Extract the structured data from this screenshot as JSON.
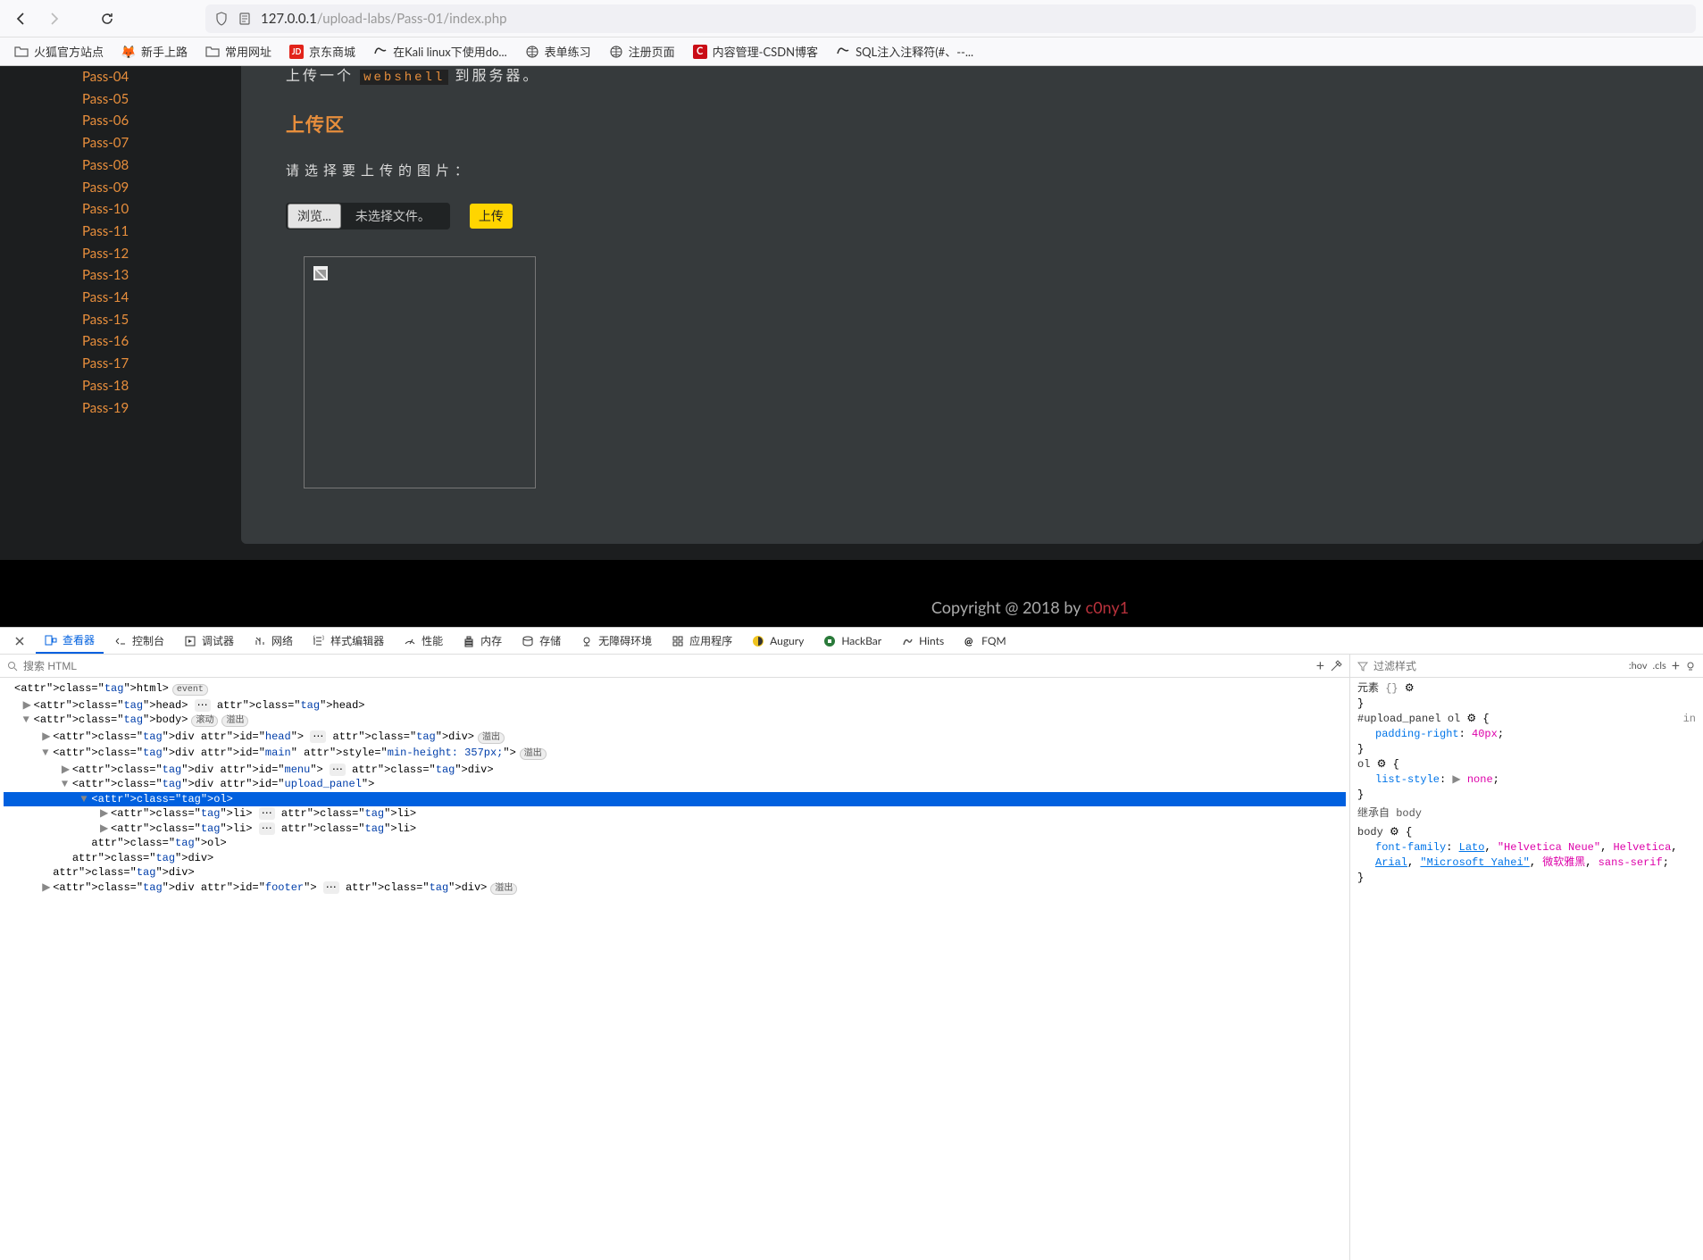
{
  "browser": {
    "url_host": "127.0.0.1",
    "url_path": "/upload-labs/Pass-01/index.php"
  },
  "bookmarks": [
    {
      "icon": "folder",
      "label": "火狐官方站点"
    },
    {
      "icon": "fox",
      "label": "新手上路"
    },
    {
      "icon": "folder",
      "label": "常用网址"
    },
    {
      "icon": "jd",
      "label": "京东商城"
    },
    {
      "icon": "kali",
      "label": "在Kali linux下使用do..."
    },
    {
      "icon": "globe",
      "label": "表单练习"
    },
    {
      "icon": "globe",
      "label": "注册页面"
    },
    {
      "icon": "c",
      "label": "内容管理-CSDN博客"
    },
    {
      "icon": "kali",
      "label": "SQL注入注释符(#、--..."
    }
  ],
  "sidebar": {
    "items": [
      "Pass-04",
      "Pass-05",
      "Pass-06",
      "Pass-07",
      "Pass-08",
      "Pass-09",
      "Pass-10",
      "Pass-11",
      "Pass-12",
      "Pass-13",
      "Pass-14",
      "Pass-15",
      "Pass-16",
      "Pass-17",
      "Pass-18",
      "Pass-19"
    ]
  },
  "content": {
    "task_prefix": "上传一个",
    "task_code": "webshell",
    "task_suffix": "到服务器。",
    "upload_heading": "上传区",
    "upload_prompt": "请选择要上传的图片：",
    "browse_label": "浏览...",
    "file_status": "未选择文件。",
    "submit_label": "上传"
  },
  "footer": {
    "copyright": "Copyright @ 2018 by",
    "author": "c0ny1"
  },
  "devtools": {
    "tabs": [
      "查看器",
      "控制台",
      "调试器",
      "网络",
      "样式编辑器",
      "性能",
      "内存",
      "存储",
      "无障碍环境",
      "应用程序",
      "Augury",
      "HackBar",
      "Hints",
      "FQM"
    ],
    "search_placeholder": "搜索 HTML",
    "html_lines": [
      {
        "indent": 0,
        "arrow": "",
        "text": "<html>",
        "badge": "event"
      },
      {
        "indent": 1,
        "arrow": "▶",
        "text": "<head> … </head>"
      },
      {
        "indent": 1,
        "arrow": "▼",
        "text": "<body>",
        "badges": [
          "滚动",
          "溢出"
        ]
      },
      {
        "indent": 2,
        "arrow": "▶",
        "text": "<div id=\"head\"> … </div>",
        "badge": "溢出"
      },
      {
        "indent": 2,
        "arrow": "▼",
        "text": "<div id=\"main\" style=\"min-height: 357px;\">",
        "badge": "溢出"
      },
      {
        "indent": 3,
        "arrow": "▶",
        "text": "<div id=\"menu\"> … </div>"
      },
      {
        "indent": 3,
        "arrow": "▼",
        "text": "<div id=\"upload_panel\">"
      },
      {
        "indent": 4,
        "arrow": "▼",
        "text": "<ol>",
        "selected": true
      },
      {
        "indent": 5,
        "arrow": "▶",
        "text": "<li> … </li>"
      },
      {
        "indent": 5,
        "arrow": "▶",
        "text": "<li> … </li>"
      },
      {
        "indent": 4,
        "arrow": "",
        "text": "</ol>"
      },
      {
        "indent": 3,
        "arrow": "",
        "text": "</div>"
      },
      {
        "indent": 2,
        "arrow": "",
        "text": "</div>"
      },
      {
        "indent": 2,
        "arrow": "▶",
        "text": "<div id=\"footer\"> … </div>",
        "badge": "溢出"
      }
    ],
    "filter_placeholder": "过滤样式",
    "hov_label": ":hov",
    "cls_label": ".cls",
    "styles": {
      "element_label": "元素",
      "rule1_sel": "#upload_panel ol",
      "rule1_prop": "padding-right",
      "rule1_val": "40px",
      "rule1_source": "in",
      "rule2_sel": "ol",
      "rule2_prop": "list-style",
      "rule2_val": "none",
      "inherit_label": "继承自 body",
      "rule3_sel": "body",
      "rule3_prop": "font-family",
      "rule3_vals": [
        "Lato",
        "\"Helvetica Neue\"",
        "Helvetica",
        "Arial",
        "\"Microsoft Yahei\"",
        "微软雅黑",
        "sans-serif"
      ]
    }
  }
}
